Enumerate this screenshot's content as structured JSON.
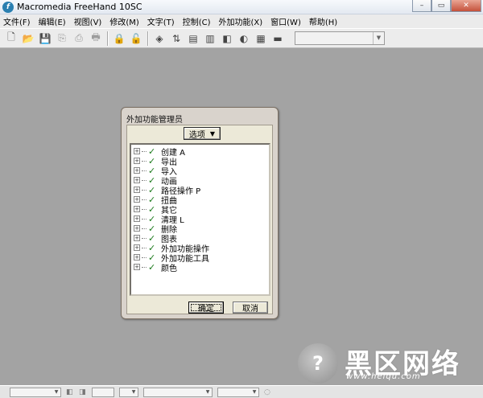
{
  "window": {
    "title": "Macromedia FreeHand 10SC",
    "controls": [
      "–",
      "▭",
      "✕"
    ]
  },
  "menubar": [
    "文件(F)",
    "编辑(E)",
    "视图(V)",
    "修改(M)",
    "文字(T)",
    "控制(C)",
    "外加功能(X)",
    "窗口(W)",
    "帮助(H)"
  ],
  "toolbar": {
    "icons": [
      "new-document-icon",
      "open-folder-icon",
      "save-icon",
      "import-icon",
      "export-icon",
      "print-icon",
      "lock-icon",
      "unlock-icon",
      "align-icon",
      "transform-icon",
      "text-editor-icon",
      "library-icon",
      "layers-icon",
      "color-mixer-icon",
      "swatches-icon",
      "stroke-icon"
    ],
    "glyphs": [
      "🗋",
      "📂",
      "💾",
      "⎘",
      "⎙",
      "🖶",
      "🔒",
      "🔓",
      "◈",
      "⇅",
      "▤",
      "▥",
      "◧",
      "◐",
      "▦",
      "▬"
    ],
    "dropdown_value": ""
  },
  "dialog": {
    "title": "外加功能管理员",
    "options_label": "选项",
    "items": [
      {
        "label": "创建 A"
      },
      {
        "label": "导出"
      },
      {
        "label": "导入"
      },
      {
        "label": "动画"
      },
      {
        "label": "路径操作 P"
      },
      {
        "label": "扭曲"
      },
      {
        "label": "其它"
      },
      {
        "label": "清理 L"
      },
      {
        "label": "删除"
      },
      {
        "label": "图表"
      },
      {
        "label": "外加功能操作"
      },
      {
        "label": "外加功能工具"
      },
      {
        "label": "颜色"
      }
    ],
    "expander_glyph": "+",
    "check_glyph": "✓",
    "ok_label": "确定",
    "cancel_label": "取消"
  },
  "watermark": {
    "text": "黑区网络",
    "url": "www.heiqu.com",
    "logo_glyph": "?"
  }
}
